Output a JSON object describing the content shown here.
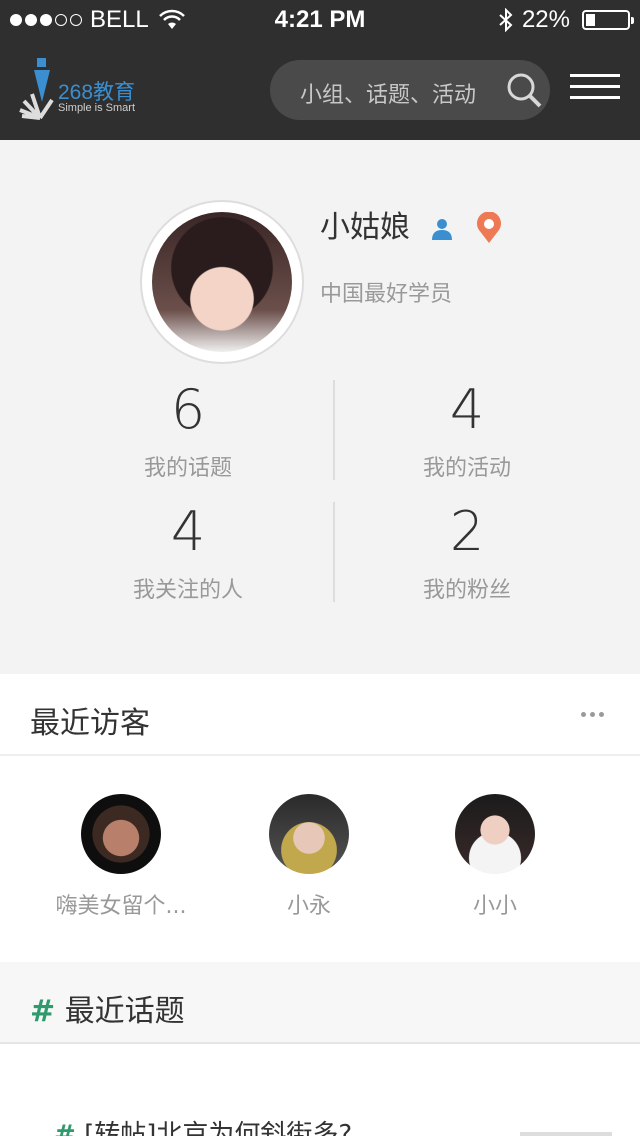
{
  "status": {
    "carrier": "BELL",
    "signal_filled": 3,
    "signal_total": 5,
    "time": "4:21 PM",
    "battery": "22%",
    "battery_level": 0.22
  },
  "header": {
    "logo_text": "268教育",
    "logo_tagline": "Simple is Smart",
    "search_placeholder": "小组、话题、活动",
    "accent": "#3b8fd0"
  },
  "profile": {
    "name": "小姑娘",
    "motto": "中国最好学员",
    "stats": [
      {
        "value": "6",
        "label": "我的话题"
      },
      {
        "value": "4",
        "label": "我的活动"
      },
      {
        "value": "4",
        "label": "我关注的人"
      },
      {
        "value": "2",
        "label": "我的粉丝"
      }
    ]
  },
  "visitors": {
    "title": "最近访客",
    "items": [
      {
        "name": "嗨美女留个..."
      },
      {
        "name": "小永"
      },
      {
        "name": "小小"
      }
    ]
  },
  "topics": {
    "hash": "#",
    "title": "最近话题",
    "items": [
      {
        "title": "[转帖]北京为何斜街多?"
      }
    ]
  },
  "colors": {
    "header_bg": "#2f2f2f",
    "topic_hash": "#2e9a6e",
    "location_pin": "#ee7a55",
    "user_icon": "#3b8fd0"
  }
}
